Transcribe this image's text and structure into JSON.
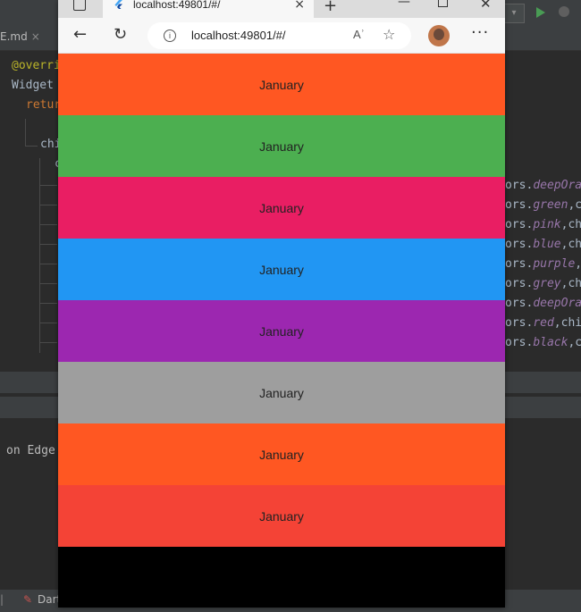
{
  "ide": {
    "tab_label": "E.md",
    "tab_close": "×",
    "code_lines": [
      {
        "prefix": "",
        "text": "@overri"
      },
      {
        "prefix": "",
        "text": "Widget "
      },
      {
        "prefix": "",
        "text": "retur"
      },
      {
        "prefix": "",
        "text": "chi"
      },
      {
        "prefix": "",
        "text": "c"
      }
    ],
    "right_code": [
      {
        "obj": "ors.",
        "name": "deepOra"
      },
      {
        "obj": "ors.",
        "name": "green",
        "rest": ",c"
      },
      {
        "obj": "ors.",
        "name": "pink",
        "rest": ",ch"
      },
      {
        "obj": "ors.",
        "name": "blue",
        "rest": ",ch"
      },
      {
        "obj": "ors.",
        "name": "purple",
        "rest": ","
      },
      {
        "obj": "ors.",
        "name": "grey",
        "rest": ",ch"
      },
      {
        "obj": "ors.",
        "name": "deepOra"
      },
      {
        "obj": "ors.",
        "name": "red",
        "rest": ",chi"
      },
      {
        "obj": "ors.",
        "name": "black",
        "rest": ",c"
      }
    ],
    "console_text": "on Edge",
    "status_items": [
      "Dart"
    ]
  },
  "browser": {
    "tab_title": "localhost:49801/#/",
    "tab_close": "×",
    "new_tab": "+",
    "url": "localhost:49801/#/",
    "read_aloud": "Aʾ",
    "menu": "···"
  },
  "bands": [
    {
      "label": "January",
      "color": "#ff5722"
    },
    {
      "label": "January",
      "color": "#4caf50"
    },
    {
      "label": "January",
      "color": "#e91e63"
    },
    {
      "label": "January",
      "color": "#2196f3"
    },
    {
      "label": "January",
      "color": "#9c27b0"
    },
    {
      "label": "January",
      "color": "#9e9e9e"
    },
    {
      "label": "January",
      "color": "#ff5722"
    },
    {
      "label": "January",
      "color": "#f44336"
    },
    {
      "label": "",
      "color": "#000000"
    }
  ]
}
